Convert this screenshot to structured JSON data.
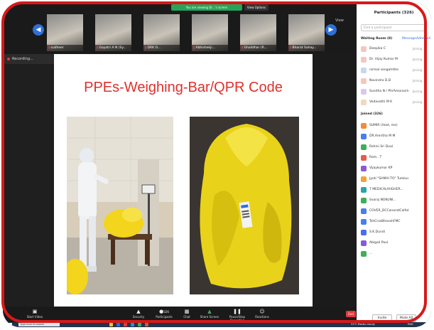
{
  "thumbnails": [
    {
      "name": "sudheer"
    },
    {
      "name": "Gayatri A N (Sy..."
    },
    {
      "name": "DRK O..."
    },
    {
      "name": "Abhishekji..."
    },
    {
      "name": "Ghalidhar (R..."
    },
    {
      "name": "Bharat Sahay..."
    }
  ],
  "top_bar": {
    "status": "You are viewing Dr...'s screen",
    "view_options": "View Options"
  },
  "strip_view": "View",
  "recording": {
    "label": "Recording..."
  },
  "slide": {
    "title": "PPEs-Weighing-Bar/QPR Code"
  },
  "participants": {
    "title": "Participants (326)",
    "search_placeholder": "Find a participant",
    "waiting_room_label": "Waiting Room (8)",
    "manage_label": "Message",
    "admit_all_label": "Admit all",
    "waiting": [
      {
        "name": "Deepika C",
        "status": "Joining..."
      },
      {
        "name": "Dr. Vijay Kumar M",
        "status": "Joining..."
      },
      {
        "name": "nirmal sengamthe",
        "status": "Joining..."
      },
      {
        "name": "Navindra D.D",
        "status": "Joining..."
      },
      {
        "name": "Sunitha N / PhrAmoravile",
        "status": "Joining..."
      },
      {
        "name": "Vedavathi M K",
        "status": "Joining..."
      }
    ],
    "joined_label": "Joined (326)",
    "joined": [
      {
        "name": "SUMIR (Host, me)",
        "color": "#f28b3a"
      },
      {
        "name": "DR.Amritha M M",
        "color": "#4a7ee8"
      },
      {
        "name": "Rohini Sri Dual",
        "color": "#3fae5a"
      },
      {
        "name": "Ram.. T",
        "color": "#e85a4a"
      },
      {
        "name": "Vijaykumar KP",
        "color": "#8a5ad6"
      },
      {
        "name": "Jyoti \"SHMAI TO\" Tumkur...",
        "color": "#f2a23a"
      },
      {
        "name": "7 MEDICAL/HIGHER...",
        "color": "#2aa5a0"
      },
      {
        "name": "Svaraj NOKUNI...",
        "color": "#3fae5a"
      },
      {
        "name": "COVER_DCCanaratCalfoK...",
        "color": "#4a7ee8"
      },
      {
        "name": "TshCrsoBhooshFMC",
        "color": "#4a7ee8"
      },
      {
        "name": "S.K.Dundi",
        "color": "#4a6ee8"
      },
      {
        "name": "Abigail Paul",
        "color": "#8a5ad6"
      },
      {
        "name": "...",
        "color": "#3fae5a"
      }
    ],
    "invite_label": "Invite",
    "mute_all_label": "Mute All"
  },
  "toolbar": {
    "items": [
      {
        "label": "Start Video",
        "icon": "video-icon"
      },
      {
        "label": "Security",
        "icon": "shield-icon"
      },
      {
        "label": "Participants",
        "icon": "people-icon",
        "count": "326"
      },
      {
        "label": "Chat",
        "icon": "chat-icon"
      },
      {
        "label": "Share Screen",
        "icon": "share-icon"
      },
      {
        "label": "Pause/Stop Recording",
        "icon": "record-icon"
      },
      {
        "label": "Reactions",
        "icon": "smile-icon"
      }
    ],
    "end_label": "End"
  },
  "taskbar": {
    "search_placeholder": "Type here to search",
    "weather": "31°C  Mostly cloudy",
    "lang": "ENG"
  },
  "colors": {
    "accent_red": "#d71919",
    "title_red": "#e0302c",
    "zoom_blue": "#2d6cdf"
  }
}
